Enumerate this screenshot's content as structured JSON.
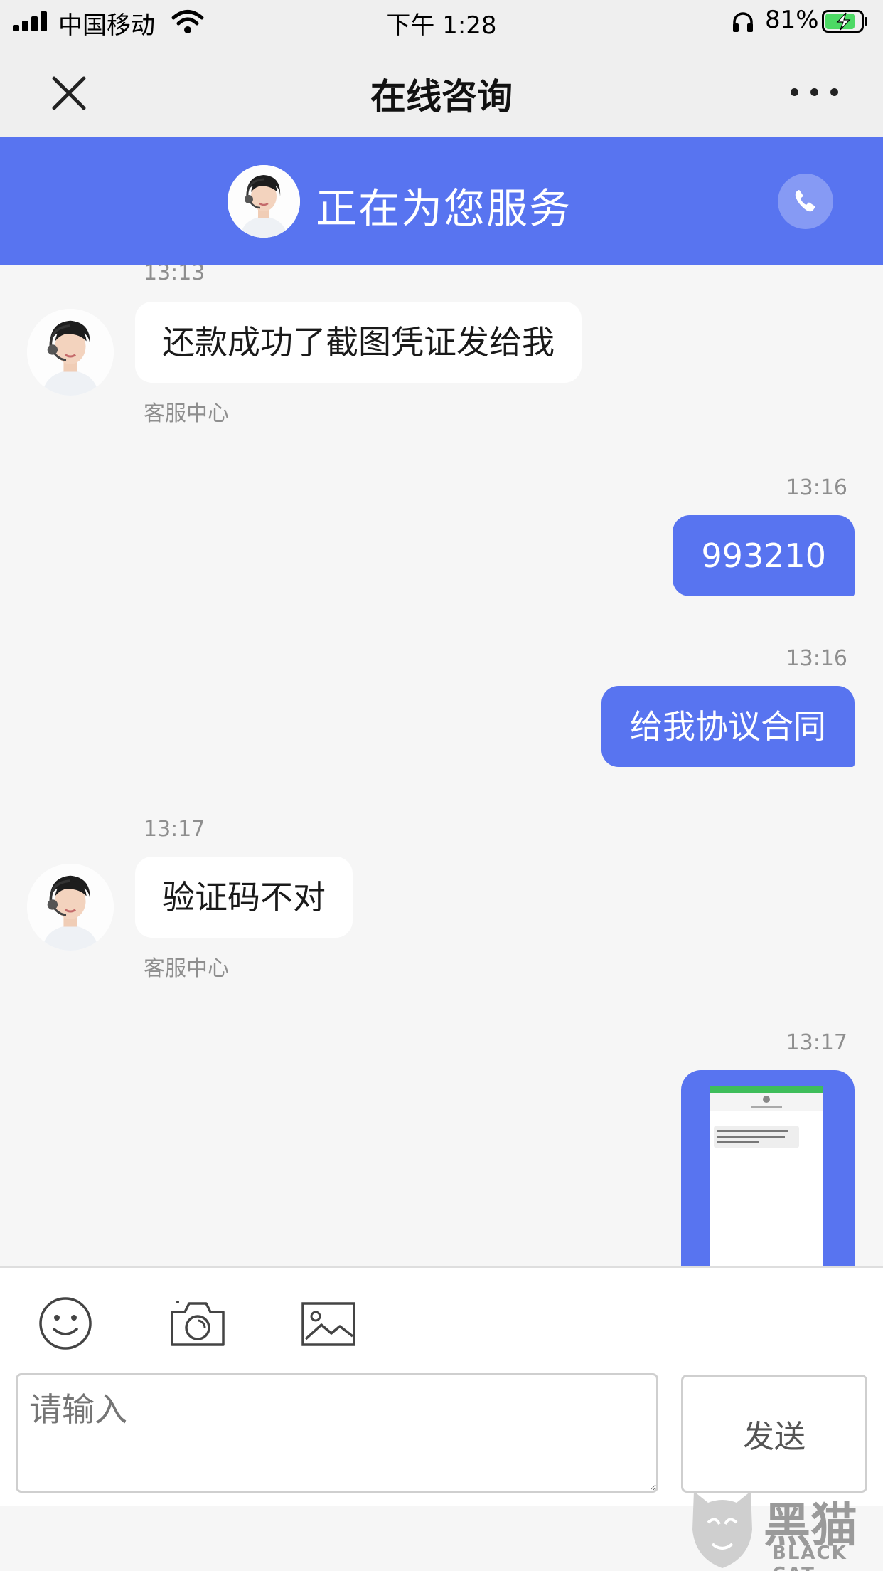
{
  "status_bar": {
    "carrier": "中国移动",
    "time": "下午 1:28",
    "battery": "81%"
  },
  "nav": {
    "title": "在线咨询"
  },
  "banner": {
    "text": "正在为您服务"
  },
  "messages": [
    {
      "time": "13:13",
      "direction": "in",
      "text": "还款成功了截图凭证发给我",
      "sender": "客服中心"
    },
    {
      "time": "13:16",
      "direction": "out",
      "text": "993210"
    },
    {
      "time": "13:16",
      "direction": "out",
      "text": "给我协议合同"
    },
    {
      "time": "13:17",
      "direction": "in",
      "text": "验证码不对",
      "sender": "客服中心"
    },
    {
      "time": "13:17",
      "direction": "out",
      "type": "image"
    }
  ],
  "composer": {
    "placeholder": "请输入",
    "send_label": "发送"
  },
  "watermark": {
    "cn": "黑猫",
    "en": "BLACK CAT"
  },
  "colors": {
    "accent": "#5874f0",
    "chat_bg": "#f6f6f6"
  },
  "icons": [
    "signal-icon",
    "wifi-icon",
    "headphone-icon",
    "battery-icon",
    "close-icon",
    "more-icon",
    "phone-icon",
    "emoji-icon",
    "camera-icon",
    "image-icon"
  ]
}
